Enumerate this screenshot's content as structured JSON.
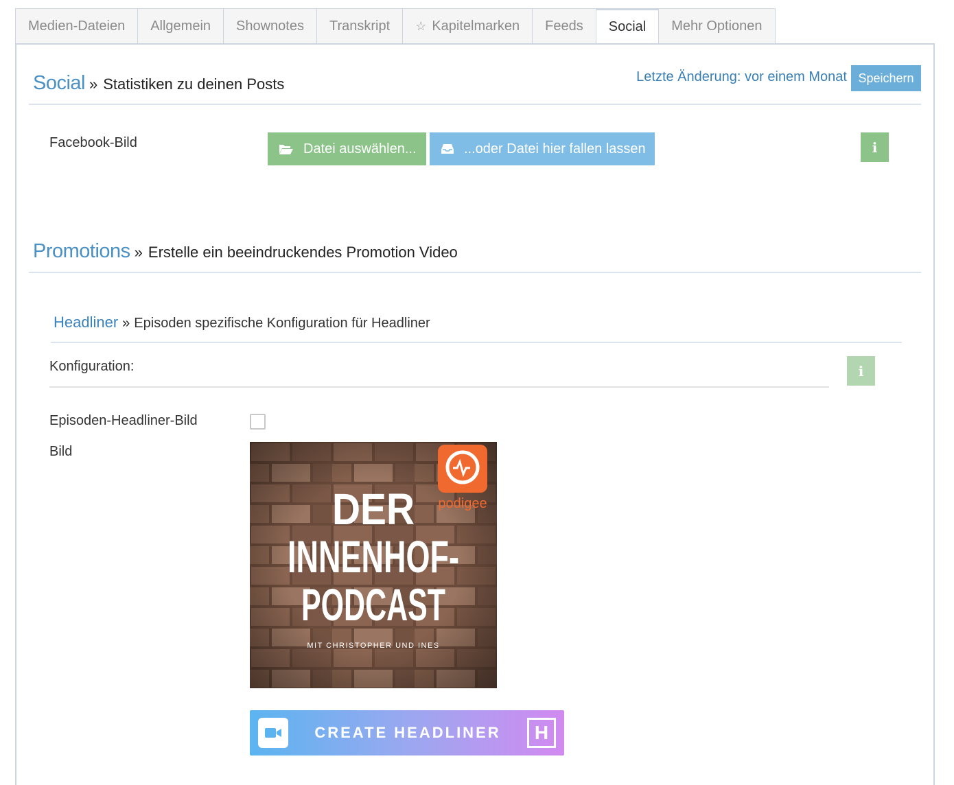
{
  "tabs": [
    {
      "label": "Medien-Dateien"
    },
    {
      "label": "Allgemein"
    },
    {
      "label": "Shownotes"
    },
    {
      "label": "Transkript"
    },
    {
      "label": "Kapitelmarken",
      "icon": "star-icon"
    },
    {
      "label": "Feeds"
    },
    {
      "label": "Social",
      "active": true
    },
    {
      "label": "Mehr Optionen"
    }
  ],
  "social": {
    "title": "Social",
    "subtitle": "Statistiken zu deinen Posts",
    "last_change": "Letzte Änderung: vor einem Monat",
    "save_label": "Speichern",
    "facebook_label": "Facebook-Bild",
    "choose_file_label": "Datei auswählen...",
    "drop_file_label": "...oder Datei hier fallen lassen"
  },
  "promotions": {
    "title": "Promotions",
    "subtitle": "Erstelle ein beeindruckendes Promotion Video"
  },
  "headliner": {
    "title": "Headliner",
    "subtitle": "Episoden spezifische Konfiguration für Headliner",
    "config_label": "Konfiguration:",
    "episode_image_label": "Episoden-Headliner-Bild",
    "episode_image_checked": false,
    "image_label": "Bild",
    "cover": {
      "line1": "DER",
      "line2": "INNENHOF-",
      "line3": "PODCAST",
      "byline": "MIT CHRISTOPHER UND INES",
      "brand": "podigee"
    },
    "create_label": "CREATE HEADLINER",
    "logo_letter": "H"
  },
  "colors": {
    "accent_blue": "#4a90c4",
    "green": "#8bc389",
    "light_blue": "#7fbde6",
    "save_blue": "#6aaed9",
    "podigee_orange": "#f06a30"
  }
}
